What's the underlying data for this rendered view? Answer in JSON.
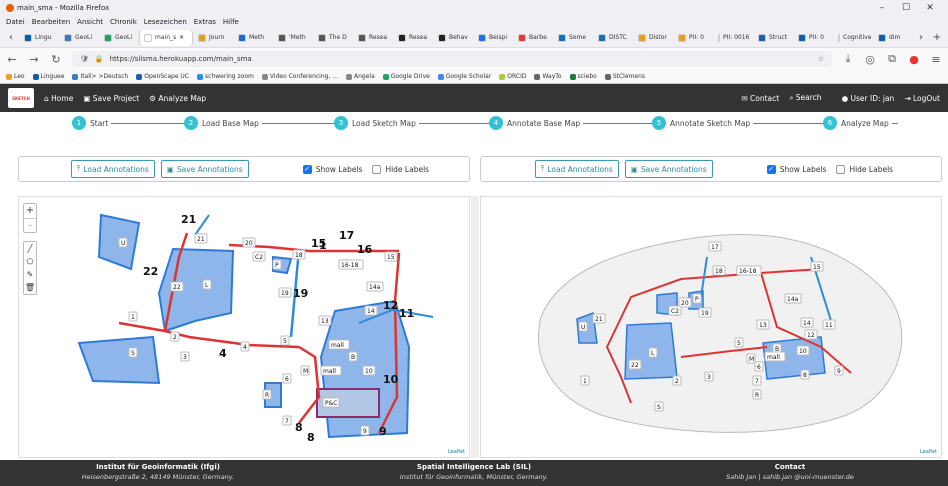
{
  "window": {
    "title": "main_sma - Mozilla Firefox"
  },
  "menu": [
    "Datei",
    "Bearbeiten",
    "Ansicht",
    "Chronik",
    "Lesezeichen",
    "Extras",
    "Hilfe"
  ],
  "tabs": [
    {
      "label": "Lingu",
      "color": "#0b5ea8"
    },
    {
      "label": "GeoLi",
      "color": "#3b7bbf"
    },
    {
      "label": "GeoLi",
      "color": "#22a35a"
    },
    {
      "label": "main_s",
      "color": "#ffffff",
      "active": true
    },
    {
      "label": "Journ",
      "color": "#e0a020"
    },
    {
      "label": "Meth",
      "color": "#1a6bd0"
    },
    {
      "label": "'Meth",
      "color": "#555555"
    },
    {
      "label": "The D",
      "color": "#555555"
    },
    {
      "label": "Resea",
      "color": "#555555"
    },
    {
      "label": "Resea",
      "color": "#222222"
    },
    {
      "label": "Behav",
      "color": "#222222"
    },
    {
      "label": "Beispi",
      "color": "#1b6ef3"
    },
    {
      "label": "Barbe",
      "color": "#e23b2e"
    },
    {
      "label": "Some",
      "color": "#1070c0"
    },
    {
      "label": "DISTC",
      "color": "#1070c0"
    },
    {
      "label": "Distor",
      "color": "#f29a1e"
    },
    {
      "label": "PII: 0",
      "color": "#f29a1e"
    },
    {
      "label": "PII: 0016",
      "color": "#ffffff"
    },
    {
      "label": "Struct",
      "color": "#1a5fb4"
    },
    {
      "label": "PII: 0",
      "color": "#0b5ea8"
    },
    {
      "label": "Cognitive",
      "color": "#ffffff"
    },
    {
      "label": "dim",
      "color": "#0b5ea8"
    }
  ],
  "url": "https://silsma.herokuapp.com/main_sma",
  "bookmarks": [
    {
      "label": "Leo",
      "color": "#f0a020"
    },
    {
      "label": "Linguee",
      "color": "#0b5ea8"
    },
    {
      "label": "Itali> >Deutsch",
      "color": "#3b7bbf"
    },
    {
      "label": "OpenScape UC",
      "color": "#1a5fb4"
    },
    {
      "label": "schwering zoom",
      "color": "#2d8cff"
    },
    {
      "label": "Video Conferencing, ...",
      "color": "#888888"
    },
    {
      "label": "Angela",
      "color": "#888888"
    },
    {
      "label": "Google Drive",
      "color": "#1fa463"
    },
    {
      "label": "Google Scholar",
      "color": "#4285f4"
    },
    {
      "label": "ORCID",
      "color": "#a6ce39"
    },
    {
      "label": "WayTo",
      "color": "#666666"
    },
    {
      "label": "sciebo",
      "color": "#1a7a3a"
    },
    {
      "label": "StClemens",
      "color": "#666666"
    }
  ],
  "app": {
    "logo": "SKETCH",
    "home": "Home",
    "save_project": "Save Project",
    "analyze_map": "Analyze Map",
    "contact": "Contact",
    "search": "Search",
    "user": "User ID: jan",
    "logout": "LogOut"
  },
  "steps": [
    {
      "num": "1",
      "label": "Start"
    },
    {
      "num": "2",
      "label": "Load Base Map"
    },
    {
      "num": "3",
      "label": "Load Sketch Map"
    },
    {
      "num": "4",
      "label": "Annotate Base Map"
    },
    {
      "num": "5",
      "label": "Annotate Sketch Map"
    },
    {
      "num": "6",
      "label": "Analyze Map"
    }
  ],
  "toolbar": {
    "load": "Load Annotations",
    "save": "Save Annotations",
    "show": "Show Labels",
    "hide": "Hide Labels"
  },
  "map": {
    "attribution": "Leaflet"
  },
  "base_labels": [
    "21",
    "21",
    "20",
    "C2",
    "15",
    "1",
    "18",
    "17",
    "16",
    "16-18",
    "15",
    "P",
    "19",
    "19",
    "L",
    "22",
    "22",
    "U",
    "1",
    "2",
    "3",
    "4",
    "4",
    "5",
    "13",
    "14a",
    "14",
    "12",
    "11",
    "S",
    "mall",
    "B",
    "M",
    "mall",
    "10",
    "10",
    "6",
    "R",
    "P&C",
    "7",
    "8",
    "8",
    "9",
    "9"
  ],
  "sketch_labels": [
    "17",
    "18",
    "16-18",
    "15",
    "21",
    "20",
    "C2",
    "P",
    "19",
    "U",
    "L",
    "22",
    "1",
    "2",
    "3",
    "S",
    "14a",
    "13",
    "14",
    "11",
    "12",
    "5",
    "B",
    "mall",
    "10",
    "M",
    "6",
    "7",
    "8",
    "9",
    "R"
  ],
  "footer": [
    {
      "title": "Institut für Geoinformatik (Ifgi)",
      "sub": "Heisenbergstraße 2, 48149 Münster, Germany."
    },
    {
      "title": "Spatial Intelligence Lab (SIL)",
      "sub": "Institut für Geoinformatik, Münster, Germany."
    },
    {
      "title": "Contact",
      "sub": "Sahib Jan | sahib.jan @uni-muenster.de"
    }
  ]
}
